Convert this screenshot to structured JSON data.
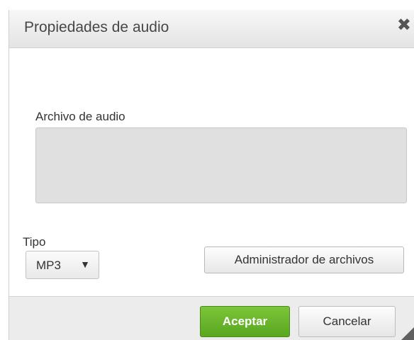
{
  "dialog": {
    "title": "Propiedades de audio",
    "close_symbol": "✖"
  },
  "audio": {
    "label": "Archivo de audio",
    "value": ""
  },
  "type": {
    "label": "Tipo",
    "selected": "MP3",
    "caret": "▼"
  },
  "file_manager": {
    "label": "Administrador de archivos"
  },
  "footer": {
    "accept_label": "Aceptar",
    "cancel_label": "Cancelar"
  },
  "colors": {
    "accept": "#5aa621",
    "title_text": "#474747",
    "field_bg": "#e0e0e0"
  },
  "icons": {
    "close": "close-icon",
    "dropdown": "chevron-down-icon",
    "resize": "resize-grip-icon"
  }
}
